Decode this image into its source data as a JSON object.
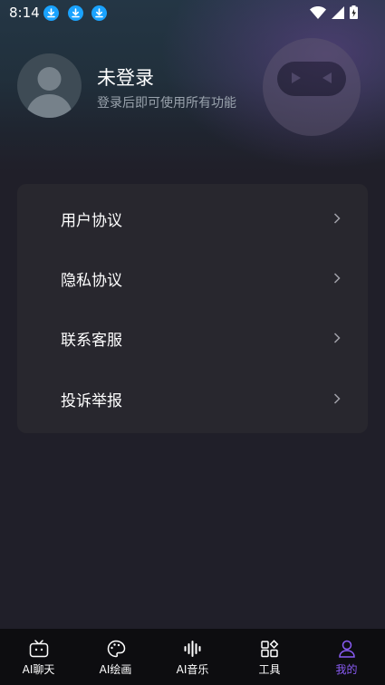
{
  "status_bar": {
    "time": "8:14",
    "download_icons": [
      "download-icon",
      "download-icon",
      "download-icon"
    ],
    "right_icons": [
      "wifi-icon",
      "signal-icon",
      "battery-icon"
    ]
  },
  "profile": {
    "name": "未登录",
    "subtitle": "登录后即可使用所有功能"
  },
  "menu": {
    "items": [
      {
        "label": "用户协议"
      },
      {
        "label": "隐私协议"
      },
      {
        "label": "联系客服"
      },
      {
        "label": "投诉举报"
      }
    ]
  },
  "tabs": [
    {
      "label": "AI聊天",
      "icon": "tv-chat-icon"
    },
    {
      "label": "AI绘画",
      "icon": "palette-icon"
    },
    {
      "label": "AI音乐",
      "icon": "soundwave-icon"
    },
    {
      "label": "工具",
      "icon": "tools-grid-icon"
    },
    {
      "label": "我的",
      "icon": "user-icon"
    }
  ],
  "active_tab": "我的",
  "colors": {
    "background": "#201f29",
    "card": "#28272e",
    "tab_bar": "#0d0d10",
    "accent": "#8a5cf6",
    "download_badge": "#1aa3ff"
  }
}
